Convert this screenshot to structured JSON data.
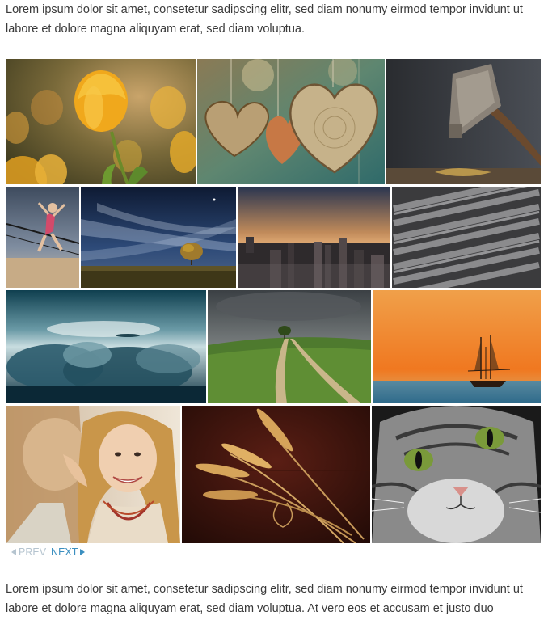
{
  "text": {
    "top_paragraph": "Lorem ipsum dolor sit amet, consetetur sadipscing elitr, sed diam nonumy eirmod tempor invidunt ut labore et dolore magna aliquyam erat, sed diam voluptua.",
    "bottom_paragraph": "Lorem ipsum dolor sit amet, consetetur sadipscing elitr, sed diam nonumy eirmod tempor invidunt ut labore et dolore magna aliquyam erat, sed diam voluptua. At vero eos et accusam et justo duo"
  },
  "pager": {
    "prev_label": "PREV",
    "next_label": "NEXT",
    "prev_icon": "triangle-left-icon",
    "next_icon": "triangle-right-icon"
  },
  "colors": {
    "prev_disabled": "#b5c4cf",
    "next_link": "#3b8fc0"
  },
  "gallery": {
    "images": [
      {
        "name": "tulips-photo"
      },
      {
        "name": "wooden-hearts-photo"
      },
      {
        "name": "hammer-photo"
      },
      {
        "name": "beach-volleyball-photo"
      },
      {
        "name": "lone-tree-night-photo"
      },
      {
        "name": "city-skyline-photo"
      },
      {
        "name": "typewriter-letters-photo"
      },
      {
        "name": "storm-clouds-photo"
      },
      {
        "name": "hill-path-tree-photo"
      },
      {
        "name": "sailboat-sunset-photo"
      },
      {
        "name": "two-women-whisper-photo"
      },
      {
        "name": "wheat-ears-photo"
      },
      {
        "name": "cat-face-photo"
      }
    ]
  }
}
